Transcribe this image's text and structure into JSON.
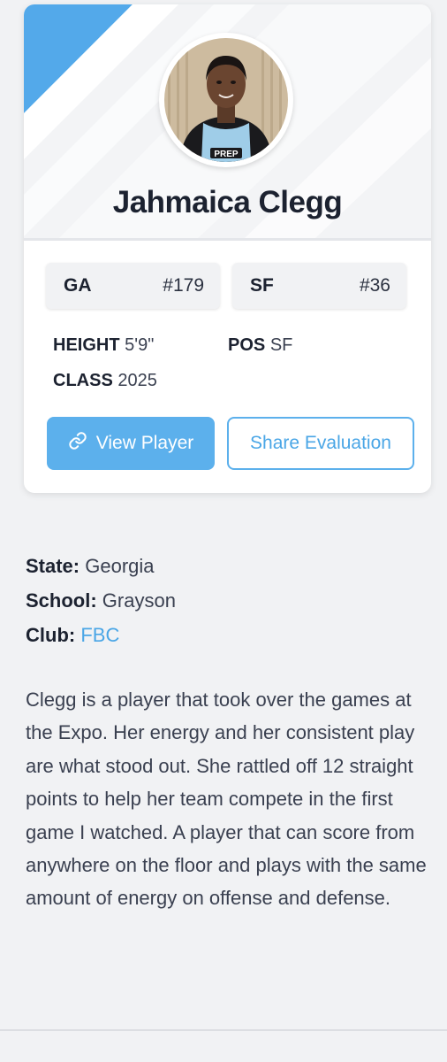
{
  "player": {
    "name": "Jahmaica Clegg",
    "photo_jersey_text": "PREP"
  },
  "rankings": [
    {
      "label": "GA",
      "rank": "#179"
    },
    {
      "label": "SF",
      "rank": "#36"
    }
  ],
  "info": {
    "height_label": "HEIGHT",
    "height_value": "5'9\"",
    "pos_label": "POS",
    "pos_value": "SF",
    "class_label": "CLASS",
    "class_value": "2025"
  },
  "buttons": {
    "view_player": "View Player",
    "share_evaluation": "Share Evaluation"
  },
  "details": {
    "state_label": "State:",
    "state_value": "Georgia",
    "school_label": "School:",
    "school_value": "Grayson",
    "club_label": "Club:",
    "club_value": "FBC"
  },
  "bio": "Clegg is a player that took over the games at the Expo. Her energy and her consistent play are what stood out. She rattled off 12 straight points to help her team compete in the first game I watched. A player that can score from anywhere on the floor and plays with the same amount of energy on offense and defense.",
  "colors": {
    "accent": "#5cb0ec",
    "link": "#4aa6e6",
    "text_dark": "#1c2230",
    "text_body": "#3a4050"
  },
  "icons": {
    "view_player": "link-icon"
  }
}
